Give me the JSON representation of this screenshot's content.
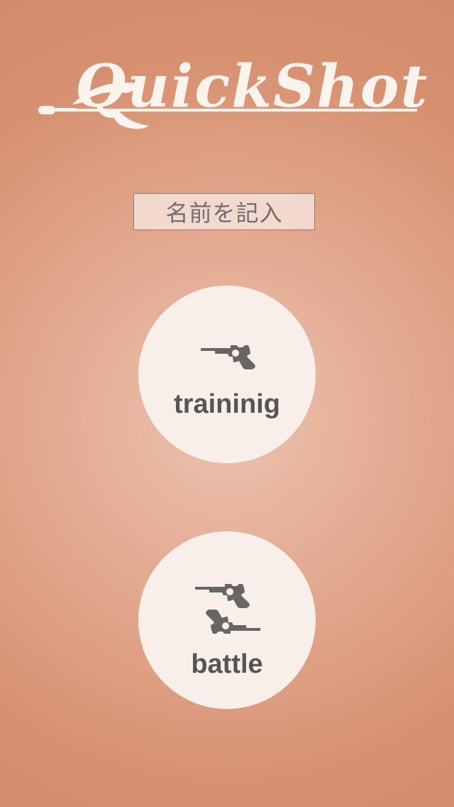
{
  "app": {
    "title": "QuickShot"
  },
  "name_input": {
    "label": "名前を記入"
  },
  "modes": {
    "training": {
      "label": "traininig"
    },
    "battle": {
      "label": "battle"
    }
  },
  "colors": {
    "background": "#dca085",
    "button_fill": "#f8efea",
    "text_dark": "#555555",
    "logo": "#fbf3ee"
  },
  "icons": {
    "logo": "revolver-logo-icon",
    "training": "revolver-icon",
    "battle": "two-revolvers-icon"
  }
}
